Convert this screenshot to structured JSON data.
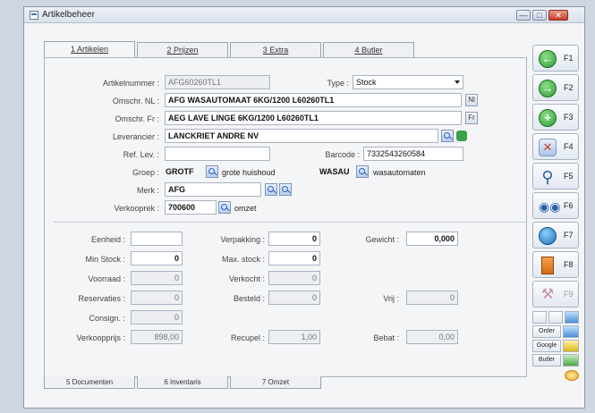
{
  "window": {
    "title": "Artikelbeheer",
    "controls": {
      "minimize": "—",
      "maximize": "□",
      "close": "✕"
    }
  },
  "tabs": [
    {
      "label": "1 Artikelen",
      "active": true
    },
    {
      "label": "2 Prijzen",
      "active": false
    },
    {
      "label": "3 Extra",
      "active": false
    },
    {
      "label": "4 Butler",
      "active": false
    }
  ],
  "bottom_tabs": [
    {
      "label": "5 Documenten"
    },
    {
      "label": "6 Inventaris"
    },
    {
      "label": "7 Omzet"
    }
  ],
  "form": {
    "artikelnummer": {
      "label": "Artikelnummer :",
      "value": "AFG60260TL1"
    },
    "type": {
      "label": "Type :",
      "value": "Stock"
    },
    "omschr_nl": {
      "label": "Omschr. NL :",
      "value": "AFG WASAUTOMAAT 6KG/1200 L60260TL1",
      "lang_btn": "Nl"
    },
    "omschr_fr": {
      "label": "Omschr. Fr :",
      "value": "AEG LAVE LINGE 6KG/1200 L60260TL1",
      "lang_btn": "Fr"
    },
    "leverancier": {
      "label": "Leverancier :",
      "value": "LANCKRIET ANDRE NV"
    },
    "ref_lev": {
      "label": "Ref. Lev. :",
      "value": ""
    },
    "barcode": {
      "label": "Barcode :",
      "value": "7332543260584"
    },
    "groep": {
      "label": "Groep :",
      "code": "GROTF",
      "description": "grote huishoud",
      "sub_code": "WASAU",
      "sub_description": "wasautomaten"
    },
    "merk": {
      "label": "Merk :",
      "value": "AFG"
    },
    "verkooprek": {
      "label": "Verkooprek :",
      "value": "700600",
      "description": "omzet"
    }
  },
  "quantities": {
    "eenheid": {
      "label": "Eenheid :",
      "value": ""
    },
    "verpakking": {
      "label": "Verpakking :",
      "value": "0"
    },
    "gewicht": {
      "label": "Gewicht :",
      "value": "0,000"
    },
    "min_stock": {
      "label": "Min Stock :",
      "value": "0"
    },
    "max_stock": {
      "label": "Max. stock :",
      "value": "0"
    },
    "voorraad": {
      "label": "Voorraad :",
      "value": "0"
    },
    "verkocht": {
      "label": "Verkocht :",
      "value": "0"
    },
    "reservaties": {
      "label": "Reservaties :",
      "value": "0"
    },
    "besteld": {
      "label": "Besteld :",
      "value": "0"
    },
    "vrij": {
      "label": "Vrij :",
      "value": "0"
    },
    "consign": {
      "label": "Consign. :",
      "value": "0"
    },
    "verkoopprijs": {
      "label": "Verkoopprijs :",
      "value": "898,00"
    },
    "recupel": {
      "label": "Recupel :",
      "value": "1,00"
    },
    "bebat": {
      "label": "Bebat :",
      "value": "0,00"
    }
  },
  "function_buttons": [
    {
      "key": "F1",
      "icon": "arrow-left-icon",
      "enabled": true
    },
    {
      "key": "F2",
      "icon": "arrow-right-icon",
      "enabled": true
    },
    {
      "key": "F3",
      "icon": "plus-icon",
      "enabled": true
    },
    {
      "key": "F4",
      "icon": "delete-icon",
      "enabled": true
    },
    {
      "key": "F5",
      "icon": "magnifier-icon",
      "enabled": true
    },
    {
      "key": "F6",
      "icon": "binoculars-icon",
      "enabled": true
    },
    {
      "key": "F7",
      "icon": "globe-icon",
      "enabled": true
    },
    {
      "key": "F8",
      "icon": "exit-door-icon",
      "enabled": true
    },
    {
      "key": "F9",
      "icon": "tools-icon",
      "enabled": false
    }
  ],
  "side_links": {
    "order": "Order",
    "google": "Google",
    "butler": "Butler"
  }
}
